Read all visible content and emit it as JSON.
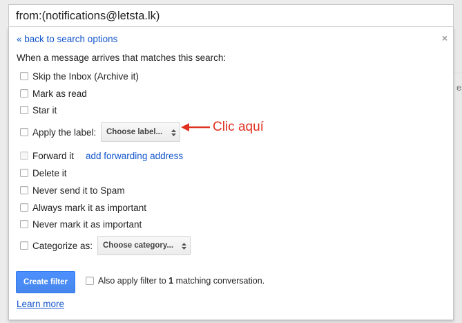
{
  "search": {
    "query": "from:(notifications@letsta.lk)"
  },
  "background": {
    "fragment": "es"
  },
  "panel": {
    "back_link": "« back to search options",
    "close_glyph": "×",
    "intro": "When a message arrives that matches this search:",
    "options": {
      "skip_inbox": "Skip the Inbox (Archive it)",
      "mark_read": "Mark as read",
      "star": "Star it",
      "apply_label": "Apply the label:",
      "forward": "Forward it",
      "delete": "Delete it",
      "never_spam": "Never send it to Spam",
      "always_important": "Always mark it as important",
      "never_important": "Never mark it as important",
      "categorize": "Categorize as:"
    },
    "label_dropdown": "Choose label...",
    "category_dropdown": "Choose category...",
    "forward_link": "add forwarding address",
    "annotation": "Clic aquí",
    "create_button": "Create filter",
    "also_apply": {
      "prefix": "Also apply filter to",
      "count": "1",
      "suffix": "matching conversation."
    },
    "learn_more": "Learn more"
  },
  "colors": {
    "accent": "#4d90fe",
    "link": "#1155cc",
    "annotation": "#e0301e"
  }
}
